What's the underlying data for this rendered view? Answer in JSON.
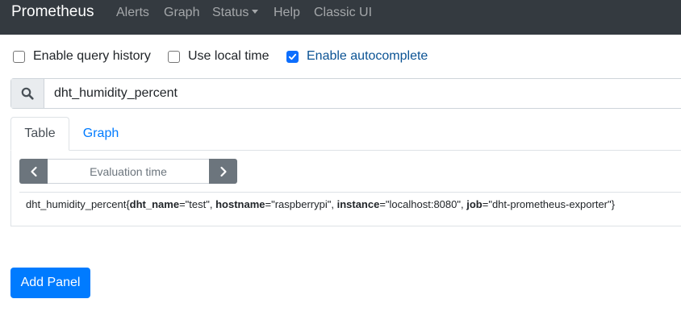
{
  "navbar": {
    "brand": "Prometheus",
    "links": [
      "Alerts",
      "Graph",
      "Status",
      "Help",
      "Classic UI"
    ]
  },
  "options": [
    {
      "label": "Enable query history",
      "checked": false
    },
    {
      "label": "Use local time",
      "checked": false
    },
    {
      "label": "Enable autocomplete",
      "checked": true
    }
  ],
  "query": {
    "value": "dht_humidity_percent",
    "icon": "search-icon"
  },
  "tabs": [
    {
      "label": "Table",
      "active": true
    },
    {
      "label": "Graph",
      "active": false
    }
  ],
  "evaluation": {
    "placeholder": "Evaluation time",
    "prev_icon": "chevron-left-icon",
    "next_icon": "chevron-right-icon"
  },
  "result": {
    "metric": "dht_humidity_percent",
    "open_brace": "{",
    "close_brace": "}",
    "labels": [
      {
        "key": "dht_name",
        "value": "\"test\""
      },
      {
        "key": "hostname",
        "value": "\"raspberrypi\""
      },
      {
        "key": "instance",
        "value": "\"localhost:8080\""
      },
      {
        "key": "job",
        "value": "\"dht-prometheus-exporter\""
      }
    ],
    "separator": ", ",
    "equals": "="
  },
  "add_panel_label": "Add Panel",
  "colors": {
    "navbar_bg": "#343a40",
    "primary": "#007bff",
    "secondary": "#6c757d"
  }
}
